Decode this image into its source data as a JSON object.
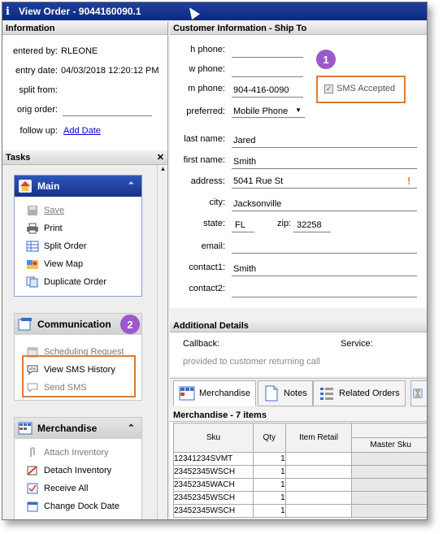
{
  "window": {
    "title": "View Order - 9044160090.1"
  },
  "information": {
    "header": "Information",
    "entered_by_label": "entered by:",
    "entered_by": "RLEONE",
    "entry_date_label": "entry date:",
    "entry_date": "04/03/2018 12:20:12 PM",
    "split_from_label": "split from:",
    "orig_order_label": "orig order:",
    "follow_up_label": "follow up:",
    "follow_up_link": "Add Date"
  },
  "tasks": {
    "header": "Tasks",
    "close": "✕",
    "main": {
      "title": "Main",
      "items": [
        {
          "label": "Save",
          "disabled": true
        },
        {
          "label": "Print"
        },
        {
          "label": "Split Order"
        },
        {
          "label": "View Map"
        },
        {
          "label": "Duplicate Order"
        }
      ]
    },
    "communication": {
      "title": "Communication",
      "items": [
        {
          "label": "Scheduling Request",
          "disabled": true
        },
        {
          "label": "View SMS History"
        },
        {
          "label": "Send SMS",
          "disabled": true
        }
      ]
    },
    "merchandise": {
      "title": "Merchandise",
      "items": [
        {
          "label": "Attach Inventory",
          "disabled": true
        },
        {
          "label": "Detach Inventory"
        },
        {
          "label": "Receive All"
        },
        {
          "label": "Change Dock Date"
        }
      ]
    }
  },
  "customer": {
    "header": "Customer Information - Ship To",
    "h_phone_label": "h phone:",
    "h_phone": "",
    "w_phone_label": "w phone:",
    "w_phone": "",
    "m_phone_label": "m phone:",
    "m_phone": "904-416-0090",
    "sms_label": "SMS Accepted",
    "preferred_label": "preferred:",
    "preferred": "Mobile Phone",
    "last_name_label": "last name:",
    "last_name": "Jared",
    "first_name_label": "first name:",
    "first_name": "Smith",
    "address_label": "address:",
    "address": "5041 Rue St",
    "address_warning": "!",
    "city_label": "city:",
    "city": "Jacksonville",
    "state_label": "state:",
    "state": "FL",
    "zip_label": "zip:",
    "zip": "32258",
    "email_label": "email:",
    "email": "",
    "contact1_label": "contact1:",
    "contact1": "Smith",
    "contact2_label": "contact2:",
    "contact2": ""
  },
  "additional": {
    "header": "Additional Details",
    "callback_label": "Callback:",
    "service_label": "Service:",
    "note": "provided to customer returning call"
  },
  "tabs": [
    {
      "label": "Merchandise"
    },
    {
      "label": "Notes"
    },
    {
      "label": "Related Orders"
    }
  ],
  "merchandise": {
    "header": "Merchandise - 7 items",
    "columns": {
      "sku": "Sku",
      "qty": "Qty",
      "item_retail": "Item Retail",
      "master_sku": "Master Sku"
    },
    "rows": [
      {
        "sku": "12341234SVMT",
        "qty": "1"
      },
      {
        "sku": "23452345WSCH",
        "qty": "1"
      },
      {
        "sku": "23452345WACH",
        "qty": "1"
      },
      {
        "sku": "23452345WSCH",
        "qty": "1"
      },
      {
        "sku": "23452345WSCH",
        "qty": "1"
      }
    ]
  },
  "callouts": {
    "one": "1",
    "two": "2"
  },
  "colors": {
    "title_bar": "#0b2a80",
    "callout_badge": "#9b59c9",
    "callout_border": "#e07a30",
    "link": "#0000cc"
  }
}
